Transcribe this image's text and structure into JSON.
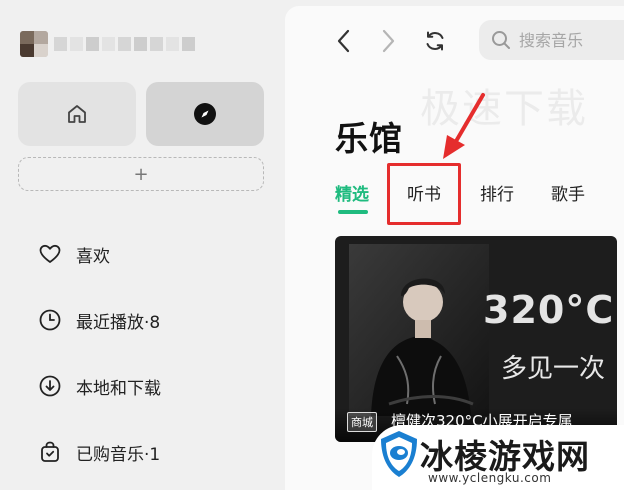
{
  "sidebar": {
    "add_label": "+",
    "menu": [
      {
        "label": "喜欢",
        "icon": "heart-icon"
      },
      {
        "label": "最近播放·8",
        "icon": "clock-icon"
      },
      {
        "label": "本地和下载",
        "icon": "download-icon"
      },
      {
        "label": "已购音乐·1",
        "icon": "shopping-bag-icon"
      }
    ],
    "nav": [
      {
        "icon": "home-icon"
      },
      {
        "icon": "compass-icon",
        "selected": true
      }
    ]
  },
  "toolbar": {
    "search_placeholder": "搜索音乐",
    "icons": [
      "back-arrow-icon",
      "forward-arrow-icon",
      "refresh-icon",
      "search-icon"
    ]
  },
  "main": {
    "watermark": "极速下载",
    "title": "乐馆",
    "tabs": [
      {
        "label": "精选",
        "active": true
      },
      {
        "label": "听书",
        "highlighted": true
      },
      {
        "label": "排行"
      },
      {
        "label": "歌手"
      }
    ],
    "banner": {
      "headline": "320°C",
      "subhead": "多见一次",
      "tag": "商城",
      "caption": "檀健次320°C小展开启专属"
    }
  },
  "overlay_logo": {
    "text": "冰棱游戏网",
    "url": "www.yclengku.com"
  },
  "colors": {
    "accent": "#1fbb7f",
    "highlight": "#e52d2d",
    "sidebar_bg": "#f0f0f0",
    "main_bg": "#fafafa"
  }
}
